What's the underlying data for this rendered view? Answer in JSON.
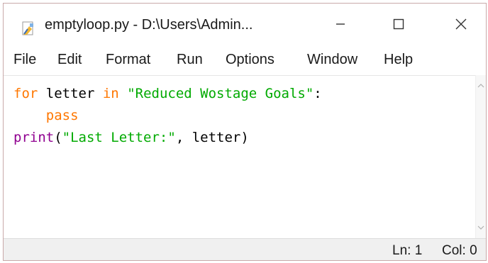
{
  "window": {
    "title": "emptyloop.py - D:\\Users\\Admin...",
    "controls": {
      "minimize": "—",
      "maximize": "☐",
      "close": "✕"
    }
  },
  "menu": [
    "File",
    "Edit",
    "Format",
    "Run",
    "Options",
    "Window",
    "Help"
  ],
  "code": {
    "line1": {
      "kw1": "for",
      "t1": " letter ",
      "kw2": "in",
      "t2": " ",
      "str": "\"Reduced Wostage Goals\"",
      "t3": ":"
    },
    "line2": {
      "indent": "    ",
      "kw": "pass"
    },
    "line3": {
      "bi": "print",
      "t1": "(",
      "str": "\"Last Letter:\"",
      "t2": ", letter)"
    }
  },
  "status": {
    "line": "Ln: 1",
    "col": "Col: 0"
  },
  "colors": {
    "keyword": "#ff7700",
    "string": "#00aa00",
    "builtin": "#900090"
  },
  "icons": {
    "app": "idle-file-icon",
    "minimize": "minimize-icon",
    "maximize": "maximize-icon",
    "close": "close-icon"
  }
}
